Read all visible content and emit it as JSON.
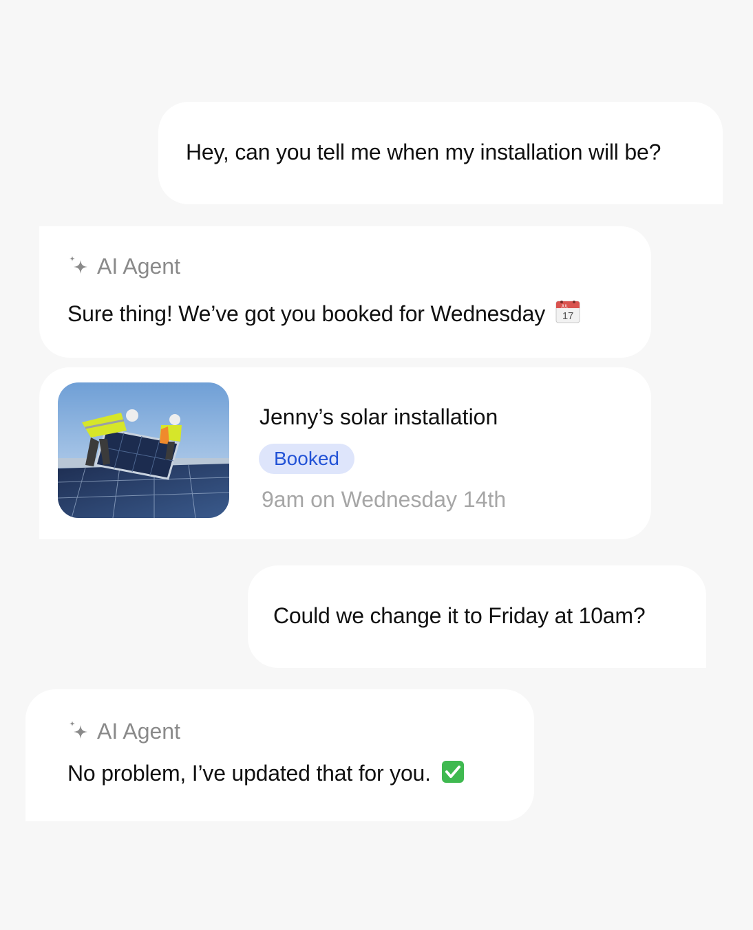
{
  "messages": {
    "user_1": "Hey, can you tell me when my installation will be?",
    "agent_1": {
      "sender": "AI Agent",
      "text": "Sure thing! We’ve got you booked for Wednesday",
      "emoji_icon": "calendar-emoji-icon",
      "calendar_month": "JUL",
      "calendar_day": "17"
    },
    "user_2": "Could we change it to Friday at 10am?",
    "agent_2": {
      "sender": "AI Agent",
      "text": "No problem, I’ve updated that for you.",
      "emoji_icon": "check-mark-emoji-icon"
    }
  },
  "booking": {
    "title": "Jenny’s solar installation",
    "status": "Booked",
    "time": "9am on Wednesday 14th",
    "image": "solar-installation-photo"
  },
  "colors": {
    "background": "#f7f7f7",
    "bubble": "#ffffff",
    "badge_bg": "#dee5fb",
    "badge_text": "#2353d6",
    "muted_text": "#8a8a8a"
  }
}
